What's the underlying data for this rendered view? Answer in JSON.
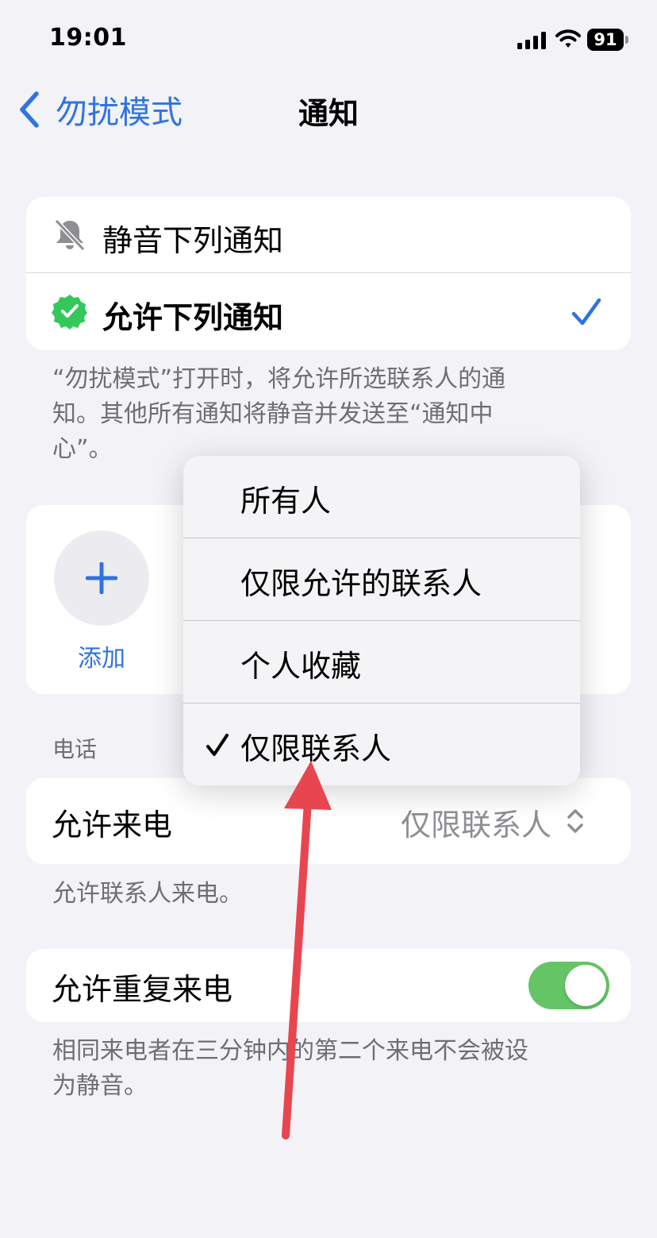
{
  "status_bar": {
    "time": "19:01",
    "battery": "91"
  },
  "nav": {
    "back_label": "勿扰模式",
    "title": "通知"
  },
  "mode_options": [
    {
      "label": "静音下列通知",
      "icon": "bell-slash-icon"
    },
    {
      "label": "允许下列通知",
      "icon": "green-badge-check-icon",
      "selected": true
    }
  ],
  "mode_note": [
    "“勿扰模式”打开时，将允许所选联系人的通",
    "知。其他所有通知将静音并发送至“通知中",
    "心”。"
  ],
  "contacts": {
    "add_label": "添加"
  },
  "phone_section": {
    "header": "电话",
    "allow_calls_label": "允许来电",
    "allow_calls_value": "仅限联系人",
    "allow_calls_note": "允许联系人来电。"
  },
  "repeat_calls": {
    "label": "允许重复来电",
    "enabled": true,
    "note": [
      "相同来电者在三分钟内的第二个来电不会被设",
      "为静音。"
    ]
  },
  "popup_menu": {
    "items": [
      {
        "label": "所有人",
        "checked": false
      },
      {
        "label": "仅限允许的联系人",
        "checked": false
      },
      {
        "label": "个人收藏",
        "checked": false
      },
      {
        "label": "仅限联系人",
        "checked": true
      }
    ]
  },
  "colors": {
    "accent": "#2f73e0",
    "toggle_on": "#65c466",
    "annotation_arrow": "#e8464f",
    "badge_green": "#34c759"
  }
}
